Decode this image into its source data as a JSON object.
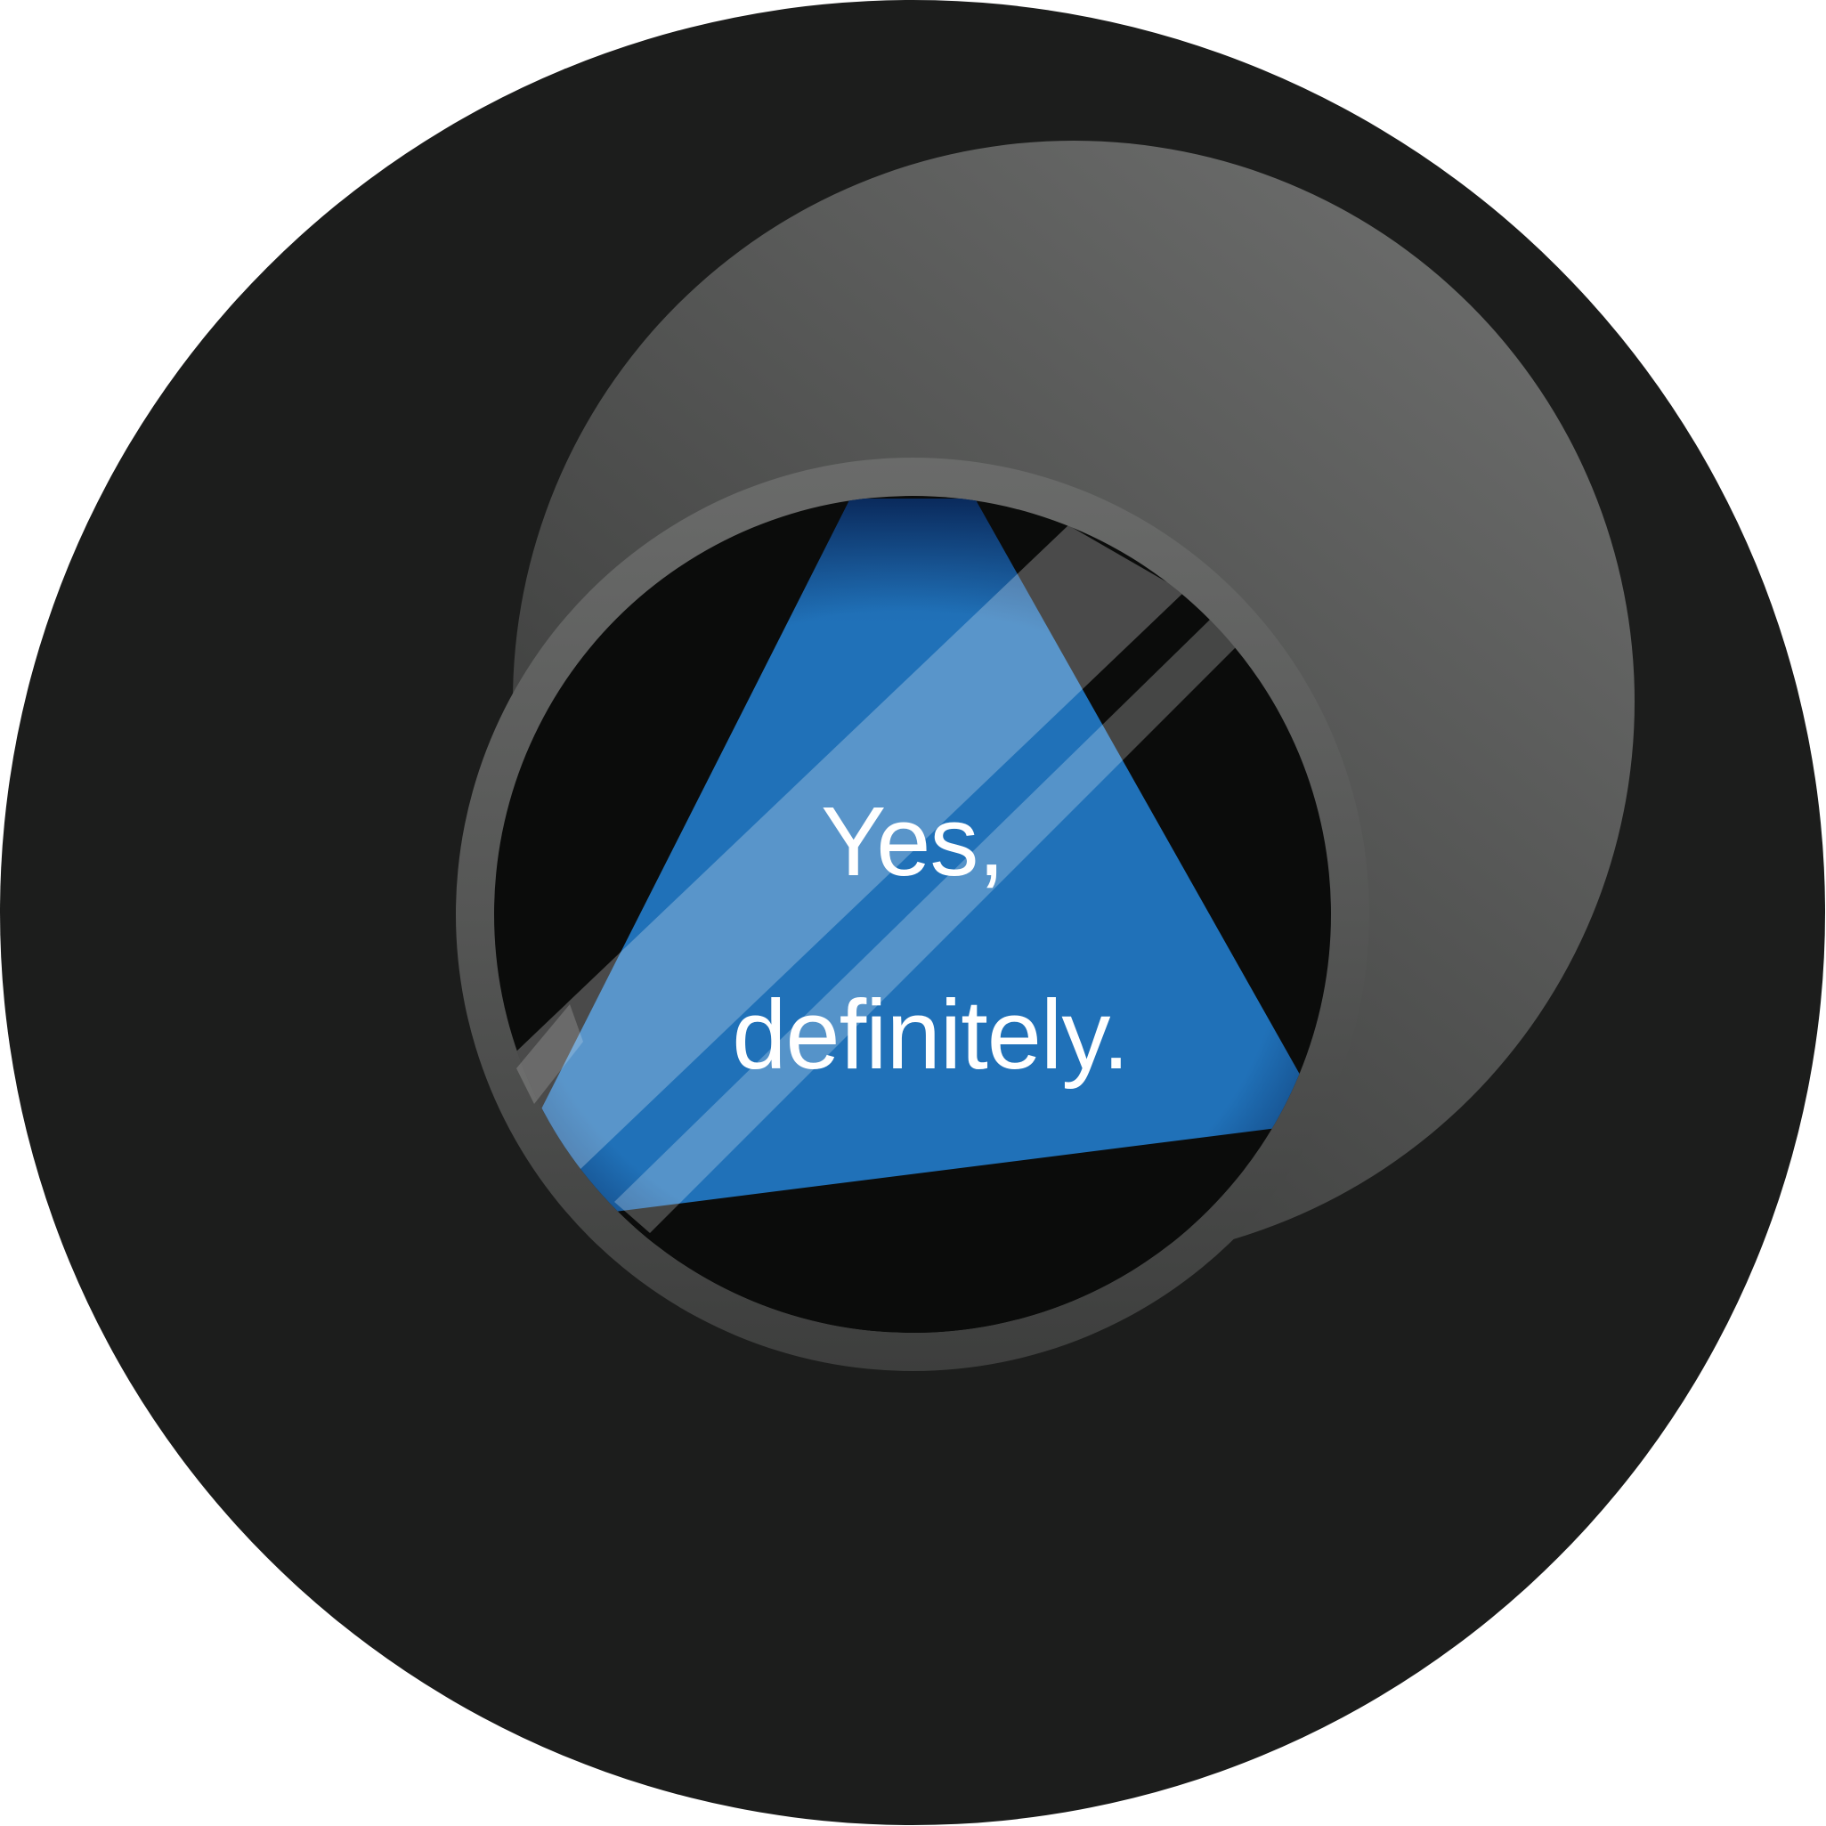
{
  "answer": {
    "line1": "Yes,",
    "line2": "definitely."
  },
  "icons": {
    "ball": "magic-8-ball-icon",
    "window": "answer-window-icon",
    "die": "answer-die-triangle-icon"
  },
  "colors": {
    "ball_body": "#1c1d1c",
    "highlight_light": "#6a6b6a",
    "highlight_dark": "#3a3b3a",
    "window_ring_light": "#6a6b6a",
    "window_ring_dark": "#3d3e3d",
    "window_inner": "#0b0c0b",
    "die_blue": "#2071b8",
    "die_blue_dark": "#0a2a5c",
    "text": "#ffffff"
  }
}
